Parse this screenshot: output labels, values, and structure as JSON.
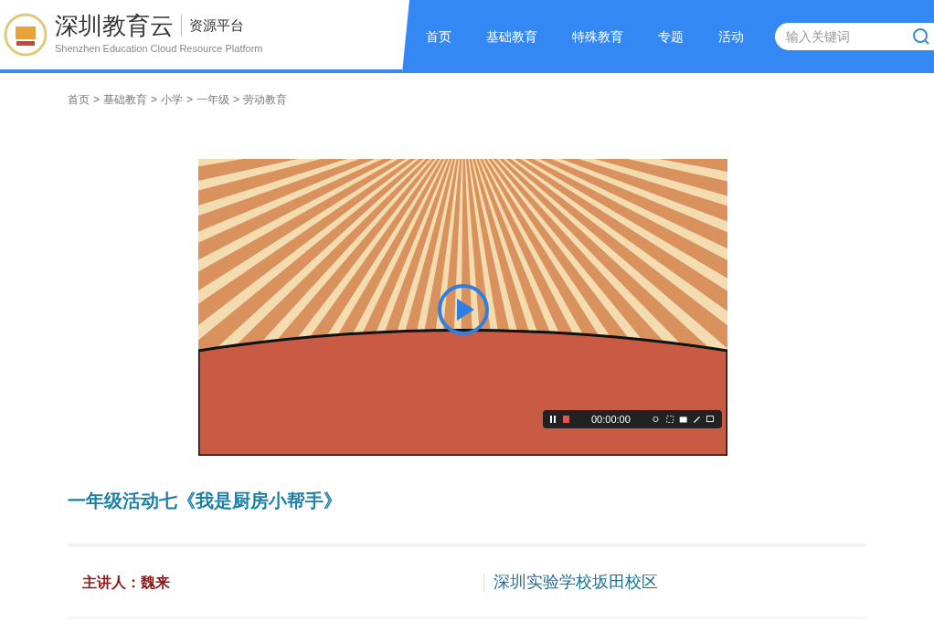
{
  "header": {
    "logo_title": "深圳教育云",
    "logo_subtitle": "资源平台",
    "logo_english": "Shenzhen Education Cloud Resource Platform"
  },
  "nav": [
    {
      "label": "首页"
    },
    {
      "label": "基础教育"
    },
    {
      "label": "特殊教育"
    },
    {
      "label": "专题"
    },
    {
      "label": "活动"
    }
  ],
  "search": {
    "placeholder": "输入关键词"
  },
  "breadcrumb": [
    "首页",
    "基础教育",
    "小学",
    "一年级",
    "劳动教育"
  ],
  "breadcrumb_separator": ">",
  "recorder": {
    "time": "00:00:00"
  },
  "title": "一年级活动七《我是厨房小帮手》",
  "info": {
    "speaker": "主讲人：魏来",
    "school": "深圳实验学校坂田校区"
  }
}
